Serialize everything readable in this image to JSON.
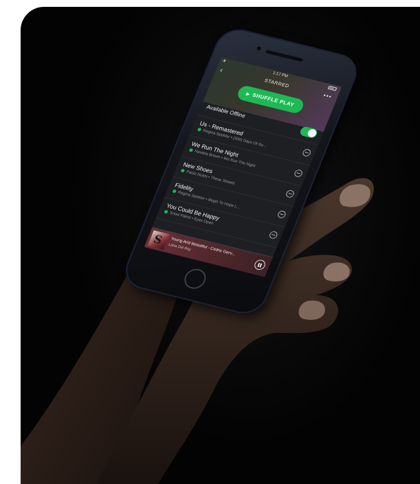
{
  "status_bar": {
    "time": "1:17 PM",
    "left_glyph": "✈"
  },
  "nav": {
    "title": "STARRED",
    "back_glyph": "‹",
    "more_glyph": "•••"
  },
  "shuffle": {
    "label": "SHUFFLE PLAY",
    "icon": "play-icon"
  },
  "offline": {
    "label": "Available Offline",
    "enabled": true
  },
  "tracks": [
    {
      "title": "Us - Remastered",
      "subtitle": "Regina Spektor • (500) Days Of Su..."
    },
    {
      "title": "We Run The Night",
      "subtitle": "Havana Brown • We Run The Night"
    },
    {
      "title": "New Shoes",
      "subtitle": "Paolo Nutini • These Streets"
    },
    {
      "title": "Fidelity",
      "subtitle": "Regina Spektor • Begin To Hope L..."
    },
    {
      "title": "You Could Be Happy",
      "subtitle": "Snow Patrol • Eyes Open"
    }
  ],
  "now_playing": {
    "title": "Young And Beautiful - Cedric Gerv...",
    "artist": "Lana Del Rey",
    "art_letter": "S"
  },
  "colors": {
    "accent": "#1db954",
    "screen_bg": "#1d1f23",
    "now_playing_bg": "#6a2e35"
  }
}
